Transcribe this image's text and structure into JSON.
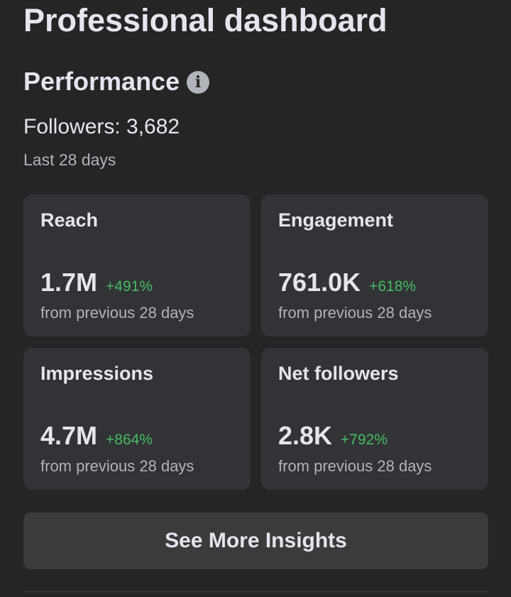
{
  "header": {
    "title": "Professional dashboard"
  },
  "performance": {
    "title": "Performance",
    "info_icon": "info-icon",
    "followers_label": "Followers: 3,682",
    "period": "Last 28 days"
  },
  "cards": [
    {
      "label": "Reach",
      "value": "1.7M",
      "change": "+491%",
      "sub": "from previous 28 days"
    },
    {
      "label": "Engagement",
      "value": "761.0K",
      "change": "+618%",
      "sub": "from previous 28 days"
    },
    {
      "label": "Impressions",
      "value": "4.7M",
      "change": "+864%",
      "sub": "from previous 28 days"
    },
    {
      "label": "Net followers",
      "value": "2.8K",
      "change": "+792%",
      "sub": "from previous 28 days"
    }
  ],
  "actions": {
    "see_more": "See More Insights"
  },
  "colors": {
    "background": "#242527",
    "card": "#323336",
    "button": "#3a3b3d",
    "positive_change": "#45bd62",
    "secondary_text": "#b0b3b8"
  }
}
